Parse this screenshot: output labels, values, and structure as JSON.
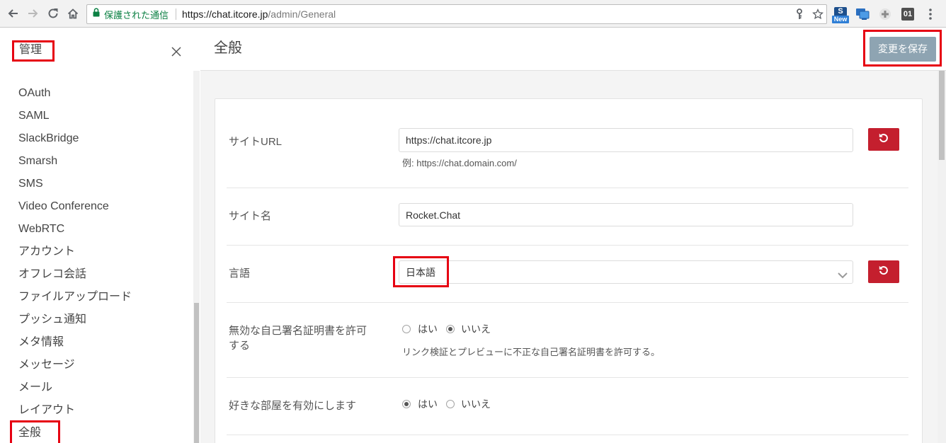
{
  "browser": {
    "secure_label": "保護された通信",
    "url_host": "https://chat.itcore.jp",
    "url_path": "/admin/General",
    "extensions": {
      "s_label": "S",
      "new_badge": "New",
      "digits_label": "01"
    }
  },
  "sidebar": {
    "title": "管理",
    "items": [
      "OAuth",
      "SAML",
      "SlackBridge",
      "Smarsh",
      "SMS",
      "Video Conference",
      "WebRTC",
      "アカウント",
      "オフレコ会話",
      "ファイルアップロード",
      "プッシュ通知",
      "メタ情報",
      "メッセージ",
      "メール",
      "レイアウト",
      "全般"
    ]
  },
  "header": {
    "title": "全般",
    "save_label": "変更を保存"
  },
  "settings": {
    "site_url": {
      "label": "サイトURL",
      "value": "https://chat.itcore.jp",
      "hint": "例: https://chat.domain.com/"
    },
    "site_name": {
      "label": "サイト名",
      "value": "Rocket.Chat"
    },
    "language": {
      "label": "言語",
      "value": "日本語"
    },
    "allow_invalid_certs": {
      "label": "無効な自己署名証明書を許可する",
      "options": [
        {
          "label": "はい",
          "checked": false
        },
        {
          "label": "いいえ",
          "checked": true
        }
      ],
      "description": "リンク検証とプレビューに不正な自己署名証明書を許可する。"
    },
    "favorite_rooms": {
      "label": "好きな部屋を有効にします",
      "options": [
        {
          "label": "はい",
          "checked": true
        },
        {
          "label": "いいえ",
          "checked": false
        }
      ]
    }
  },
  "colors": {
    "reset_button": "#c41f2e",
    "save_button": "#8ea4b2",
    "secure_green": "#0b8043",
    "annotation_red": "#e60012"
  }
}
